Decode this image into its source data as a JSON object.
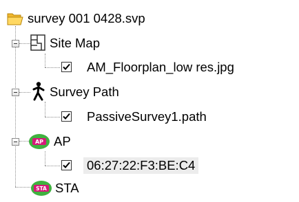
{
  "tree": {
    "root": {
      "label": "survey 001 0428.svp",
      "icon": "folder-open-icon"
    },
    "nodes": [
      {
        "label": "Site Map",
        "icon": "site-map-icon",
        "expanded": true,
        "children": [
          {
            "label": "AM_Floorplan_low res.jpg",
            "checked": true
          }
        ]
      },
      {
        "label": "Survey Path",
        "icon": "walking-person-icon",
        "expanded": true,
        "children": [
          {
            "label": "PassiveSurvey1.path",
            "checked": true
          }
        ]
      },
      {
        "label": "AP",
        "icon": "access-point-icon",
        "badge": "AP",
        "expanded": true,
        "children": [
          {
            "label": "06:27:22:F3:BE:C4",
            "checked": true,
            "selected": true
          }
        ]
      },
      {
        "label": "STA",
        "icon": "station-icon",
        "badge": "STA"
      }
    ]
  },
  "colors": {
    "folder": "#f5c84a",
    "badge_green": "#3fb23f",
    "badge_magenta": "#d6197a",
    "selection": "#ececec"
  }
}
